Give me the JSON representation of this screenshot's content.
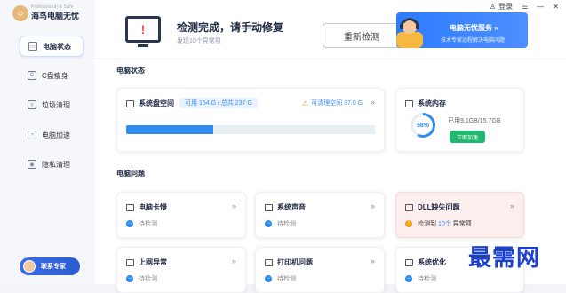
{
  "app": {
    "name_en": "Professional & Safe",
    "name_cn": "海鸟电脑无忧"
  },
  "titlebar": {
    "login": "登录",
    "menu": "☰",
    "minimize": "—",
    "close": "✕"
  },
  "sidebar": {
    "items": [
      {
        "label": "电脑状态",
        "icon": "monitor-icon",
        "active": true
      },
      {
        "label": "C盘瘦身",
        "icon": "disk-icon",
        "active": false
      },
      {
        "label": "垃圾清理",
        "icon": "trash-icon",
        "active": false
      },
      {
        "label": "电脑加速",
        "icon": "speed-icon",
        "active": false
      },
      {
        "label": "隐私清理",
        "icon": "privacy-icon",
        "active": false
      }
    ],
    "expert_button": "联系专家"
  },
  "banner": {
    "title": "检测完成，请手动修复",
    "subtitle": "发现10个异常项",
    "rescan_label": "重新检测",
    "service_title": "电脑无忧服务 »",
    "service_sub": "技术专家远程解决电脑问题"
  },
  "status_section": {
    "title": "电脑状态"
  },
  "disk": {
    "title": "系统盘空间",
    "badge": "可用 154 G / 总共 237 G",
    "clean_text": "可清理空间 37.0 G",
    "used_fraction": 0.35
  },
  "memory": {
    "title": "系统内存",
    "percent_label": "58%",
    "percent": 58,
    "used_text": "已用9.1GB/15.7GB",
    "speed_label": "立即加速"
  },
  "problems_section": {
    "title": "电脑问题"
  },
  "problems": [
    {
      "title": "电脑卡慢",
      "status": "待检测"
    },
    {
      "title": "系统声音",
      "status": "待检测"
    },
    {
      "title": "DLL缺失问题",
      "status_pre": "检测到",
      "count": "10个",
      "status_post": "异常项"
    },
    {
      "title": "上网异常",
      "status": "待检测"
    },
    {
      "title": "打印机问题",
      "status": "待检测"
    },
    {
      "title": "系统优化",
      "status": "待检测"
    }
  ],
  "watermark": "最需网",
  "colors": {
    "accent": "#2e8cf0",
    "green": "#1fb86e",
    "warning": "#f0a020",
    "alert_bg": "#fdeeee"
  }
}
